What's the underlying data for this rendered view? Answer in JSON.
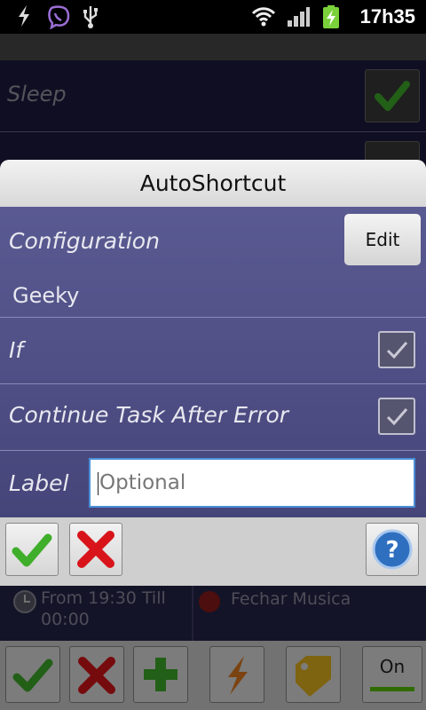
{
  "status_bar": {
    "time": "17h35",
    "icons": [
      "flash-icon",
      "viber-icon",
      "usb-icon",
      "wifi-icon",
      "signal-icon",
      "battery-charging-icon"
    ]
  },
  "background": {
    "rows": [
      {
        "label": "Sleep",
        "checked": true
      }
    ],
    "task_item": {
      "time_text": "From 19:30 Till 00:00",
      "action_text": "Fechar Musica"
    },
    "bottom_bar": {
      "on_label": "On",
      "icons": [
        "accept-icon",
        "cancel-icon",
        "add-icon",
        "lightning-icon",
        "tag-icon"
      ]
    }
  },
  "dialog": {
    "title": "AutoShortcut",
    "configuration": {
      "label": "Configuration",
      "edit_label": "Edit",
      "value": "Geeky"
    },
    "if_row": {
      "label": "If",
      "checked": true
    },
    "continue_row": {
      "label": "Continue Task After Error",
      "checked": true
    },
    "label_row": {
      "label": "Label",
      "placeholder": "Optional",
      "value": ""
    },
    "actions": [
      "accept-icon",
      "cancel-icon",
      "help-icon"
    ]
  },
  "colors": {
    "dialog_body": "#4f4f86",
    "accept_green": "#3fae2a",
    "cancel_red": "#d8141a",
    "input_focus": "#4a8fd8"
  }
}
